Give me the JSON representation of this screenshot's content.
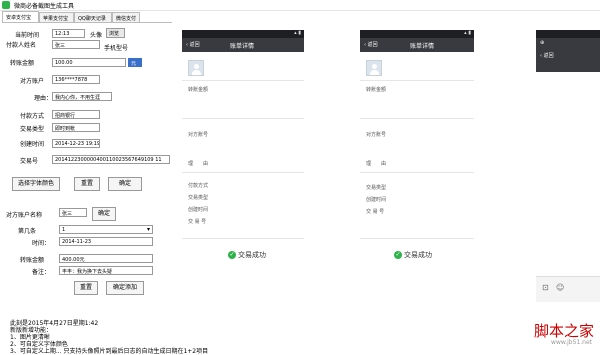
{
  "window": {
    "title": "微商必备截图生成工具"
  },
  "tabs": [
    {
      "label": "安卓支付宝"
    },
    {
      "label": "苹果支付宝"
    },
    {
      "label": "QQ聊天记录"
    },
    {
      "label": "微信支付"
    }
  ],
  "form": {
    "current_time_label": "当前时间",
    "current_time_value": "12:13",
    "avatar_label": "头像",
    "avatar_value": "浏览",
    "payer_label": "付款人姓名",
    "payer_value": "张三",
    "phone_model_label": "手机型号",
    "amount_label": "转账金额",
    "amount_value": "100.00",
    "amount_unit": "元",
    "account_label": "对方账户",
    "account_value": "136****7878",
    "reason_label": "理由：",
    "reason_value": "我内心你，不用生涯",
    "pay_method_label": "付款方式",
    "pay_method_value": "招商银行",
    "tx_type_label": "交易类型",
    "tx_type_value": "即时到帐",
    "created_label": "创建时间",
    "created_value": "2014-12-23 19:19",
    "tx_no_label": "交易号",
    "tx_no_value": "2014122300000400110023567649109 11",
    "font_color_button": "选择字体颜色",
    "reset_button": "重置",
    "ok_button": "确定"
  },
  "form2": {
    "account_name_label": "对方账户名称",
    "account_name_value": "张三",
    "ok_button": "确定",
    "nth_label": "第几条",
    "nth_value": "1",
    "time_label": "时间：",
    "time_value": "2014-11-23",
    "amount_label": "转账金额",
    "amount_value": "400.00元",
    "note_label": "备注：",
    "note_value": "丰丰：我为换下去头疑",
    "reset_button": "重置",
    "add_button": "确定添加"
  },
  "info": {
    "line1": "此刻是2015年4月27日星期1:42",
    "line2": "新版新增功能：",
    "line3": "1、图片更清晰",
    "line4": "2、可自定义字体颜色",
    "line5": "3、可自定义上期... 只支持头像照片到最后日志的自动生成日期在1+2项目"
  },
  "phone1": {
    "back": "返回",
    "title": "账单详情",
    "amount_label": "转账金额",
    "account_label": "对方账号",
    "reason_label": "理　　由",
    "pay_method_label": "付款方式",
    "tx_type_label": "交易类型",
    "created_label": "创建时间",
    "tx_no_label": "交 易 号",
    "status": "交易成功"
  },
  "phone2": {
    "back": "返回",
    "title": "账单详情",
    "amount_label": "转账金额",
    "account_label": "对方账号",
    "reason_label": "理　　由",
    "tx_type_label": "交易类型",
    "created_label": "创建时间",
    "tx_no_label": "交 易 号",
    "status": "交易成功"
  },
  "phone3": {
    "back": "返回"
  },
  "watermark": {
    "main": "脚本之家",
    "sub": "www.jb51.net"
  },
  "colors": {
    "success_green": "#2db34a",
    "header_dark": "#393a3f",
    "watermark_red": "#cc0000"
  }
}
